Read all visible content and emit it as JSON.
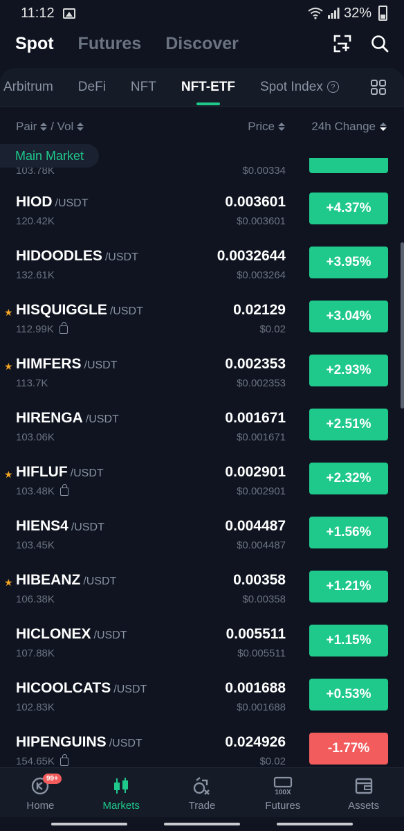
{
  "status_bar": {
    "time": "11:12",
    "battery": "32%"
  },
  "top_tabs": [
    "Spot",
    "Futures",
    "Discover"
  ],
  "categories": [
    "Arbitrum",
    "DeFi",
    "NFT",
    "NFT-ETF",
    "Spot Index"
  ],
  "sort_header": {
    "pair": "Pair",
    "vol": "/ Vol",
    "price": "Price",
    "change": "24h Change"
  },
  "main_market_label": "Main Market",
  "partial_row": {
    "vol": "103.78K",
    "usd": "$0.00334"
  },
  "rows": [
    {
      "starred": false,
      "base": "HIOD",
      "quote": "/USDT",
      "vol": "120.42K",
      "lock": false,
      "price": "0.003601",
      "usd": "$0.003601",
      "change": "+4.37%",
      "positive": true
    },
    {
      "starred": false,
      "base": "HIDOODLES",
      "quote": "/USDT",
      "vol": "132.61K",
      "lock": false,
      "price": "0.0032644",
      "usd": "$0.003264",
      "change": "+3.95%",
      "positive": true
    },
    {
      "starred": true,
      "base": "HISQUIGGLE",
      "quote": "/USDT",
      "vol": "112.99K",
      "lock": true,
      "price": "0.02129",
      "usd": "$0.02",
      "change": "+3.04%",
      "positive": true
    },
    {
      "starred": true,
      "base": "HIMFERS",
      "quote": "/USDT",
      "vol": "113.7K",
      "lock": false,
      "price": "0.002353",
      "usd": "$0.002353",
      "change": "+2.93%",
      "positive": true
    },
    {
      "starred": false,
      "base": "HIRENGA",
      "quote": "/USDT",
      "vol": "103.06K",
      "lock": false,
      "price": "0.001671",
      "usd": "$0.001671",
      "change": "+2.51%",
      "positive": true
    },
    {
      "starred": true,
      "base": "HIFLUF",
      "quote": "/USDT",
      "vol": "103.48K",
      "lock": true,
      "price": "0.002901",
      "usd": "$0.002901",
      "change": "+2.32%",
      "positive": true
    },
    {
      "starred": false,
      "base": "HIENS4",
      "quote": "/USDT",
      "vol": "103.45K",
      "lock": false,
      "price": "0.004487",
      "usd": "$0.004487",
      "change": "+1.56%",
      "positive": true
    },
    {
      "starred": true,
      "base": "HIBEANZ",
      "quote": "/USDT",
      "vol": "106.38K",
      "lock": false,
      "price": "0.00358",
      "usd": "$0.00358",
      "change": "+1.21%",
      "positive": true
    },
    {
      "starred": false,
      "base": "HICLONEX",
      "quote": "/USDT",
      "vol": "107.88K",
      "lock": false,
      "price": "0.005511",
      "usd": "$0.005511",
      "change": "+1.15%",
      "positive": true
    },
    {
      "starred": false,
      "base": "HICOOLCATS",
      "quote": "/USDT",
      "vol": "102.83K",
      "lock": false,
      "price": "0.001688",
      "usd": "$0.001688",
      "change": "+0.53%",
      "positive": true
    },
    {
      "starred": false,
      "base": "HIPENGUINS",
      "quote": "/USDT",
      "vol": "154.65K",
      "lock": true,
      "price": "0.024926",
      "usd": "$0.02",
      "change": "-1.77%",
      "positive": false
    }
  ],
  "bottom_nav": {
    "home": "Home",
    "home_badge": "99+",
    "markets": "Markets",
    "trade": "Trade",
    "futures": "Futures",
    "futures_icon_text": "100X",
    "assets": "Assets"
  },
  "colors": {
    "positive": "#1fc98c",
    "negative": "#f25c5c",
    "star": "#f5a623",
    "background": "#0f1420"
  }
}
